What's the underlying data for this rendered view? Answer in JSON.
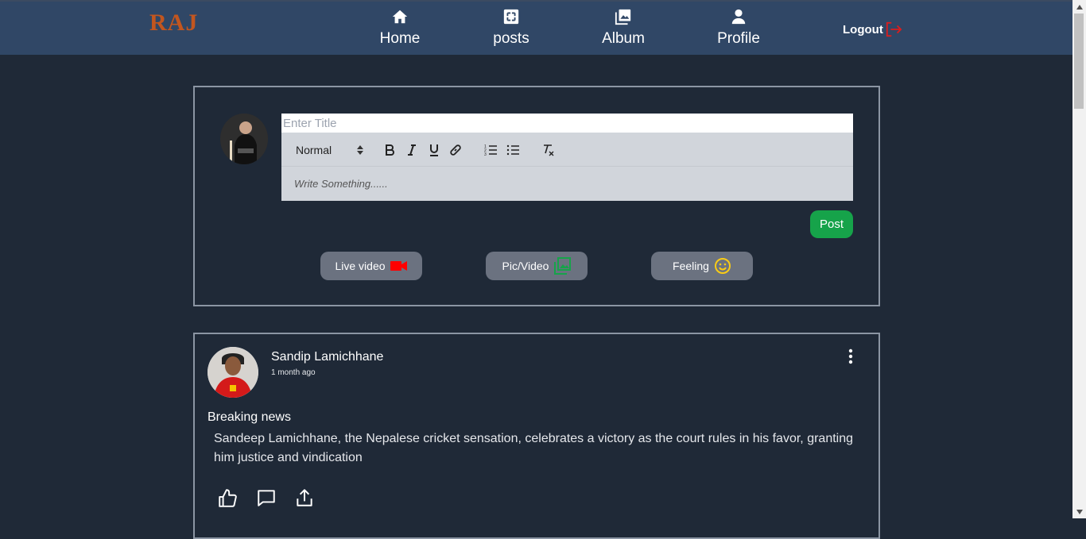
{
  "header": {
    "brand": "RAJ",
    "nav": [
      {
        "label": "Home",
        "icon": "home-icon"
      },
      {
        "label": "posts",
        "icon": "expand-icon"
      },
      {
        "label": "Album",
        "icon": "images-icon"
      },
      {
        "label": "Profile",
        "icon": "user-icon"
      }
    ],
    "logout_label": "Logout",
    "brand_color": "#c2561f",
    "bg_color": "#304766"
  },
  "composer": {
    "title_placeholder": "Enter Title",
    "format_select": "Normal",
    "toolbar": [
      "bold-icon",
      "italic-icon",
      "underline-icon",
      "link-icon",
      "ordered-list-icon",
      "bullet-list-icon",
      "clear-format-icon"
    ],
    "body_placeholder": "Write Something......",
    "post_button": "Post",
    "actions": [
      {
        "label": "Live video",
        "icon": "video-camera-icon",
        "icon_color": "#ff0000"
      },
      {
        "label": "Pic/Video",
        "icon": "photo-library-icon",
        "icon_color": "#16a34a"
      },
      {
        "label": "Feeling",
        "icon": "smiley-icon",
        "icon_color": "#facc15"
      }
    ]
  },
  "post": {
    "author": "Sandip Lamichhane",
    "time": "1 month ago",
    "title": "Breaking news",
    "body": "Sandeep Lamichhane, the Nepalese cricket sensation, celebrates a victory as the court rules in his favor, granting him justice and vindication",
    "reactions": [
      "like-icon",
      "comment-icon",
      "share-icon"
    ]
  }
}
